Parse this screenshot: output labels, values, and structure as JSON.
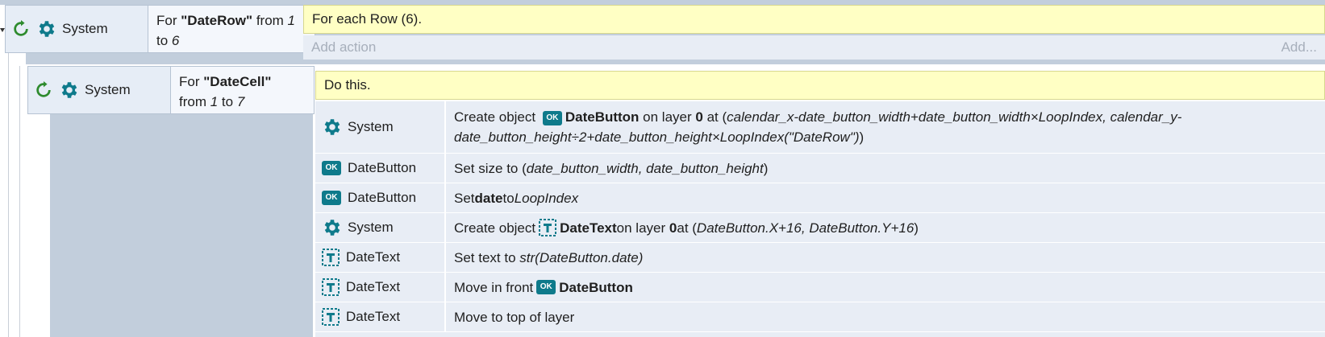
{
  "event1": {
    "object": "System",
    "condition": {
      "prefix": "For ",
      "var": "\"DateRow\"",
      "mid": " from ",
      "start": "1",
      "to": " to ",
      "end": "6"
    },
    "comment": "For each Row (6).",
    "add_action": "Add action",
    "add_short": "Add..."
  },
  "event2": {
    "object": "System",
    "condition": {
      "prefix": "For ",
      "var": "\"DateCell\"",
      "mid": " from ",
      "start": "1",
      "to": " to ",
      "end": "7"
    },
    "comment": "Do this.",
    "actions": [
      {
        "object": "System",
        "icon": "gear",
        "t1": "Create object ",
        "obj": "DateButton",
        "t2": " on layer ",
        "layer": "0",
        "t3": " at (",
        "expr": "calendar_x-date_button_width+date_button_width×LoopIndex, calendar_y-date_button_height÷2+date_button_height×LoopIndex(\"DateRow\")",
        "t4": ")"
      },
      {
        "object": "DateButton",
        "icon": "ok",
        "t1": "Set size to (",
        "expr": "date_button_width, date_button_height",
        "t2": ")"
      },
      {
        "object": "DateButton",
        "icon": "ok",
        "t1": "Set ",
        "prop": "date",
        "t2": " to ",
        "expr": "LoopIndex"
      },
      {
        "object": "System",
        "icon": "gear",
        "t1": "Create object ",
        "obj": "DateText",
        "t2": " on layer ",
        "layer": "0",
        "t3": " at (",
        "expr": "DateButton.X+16, DateButton.Y+16",
        "t4": ")"
      },
      {
        "object": "DateText",
        "icon": "text",
        "t1": "Set text to ",
        "expr": "str(DateButton.date)"
      },
      {
        "object": "DateText",
        "icon": "text",
        "t1": "Move in front ",
        "obj": "DateButton"
      },
      {
        "object": "DateText",
        "icon": "text",
        "t1": "Move to top of layer"
      }
    ]
  },
  "icons": {
    "ok_label": "OK"
  },
  "colors": {
    "accent": "#0e7a8b",
    "comment_bg": "#ffffc4",
    "loop_icon": "#2e8b2e"
  }
}
